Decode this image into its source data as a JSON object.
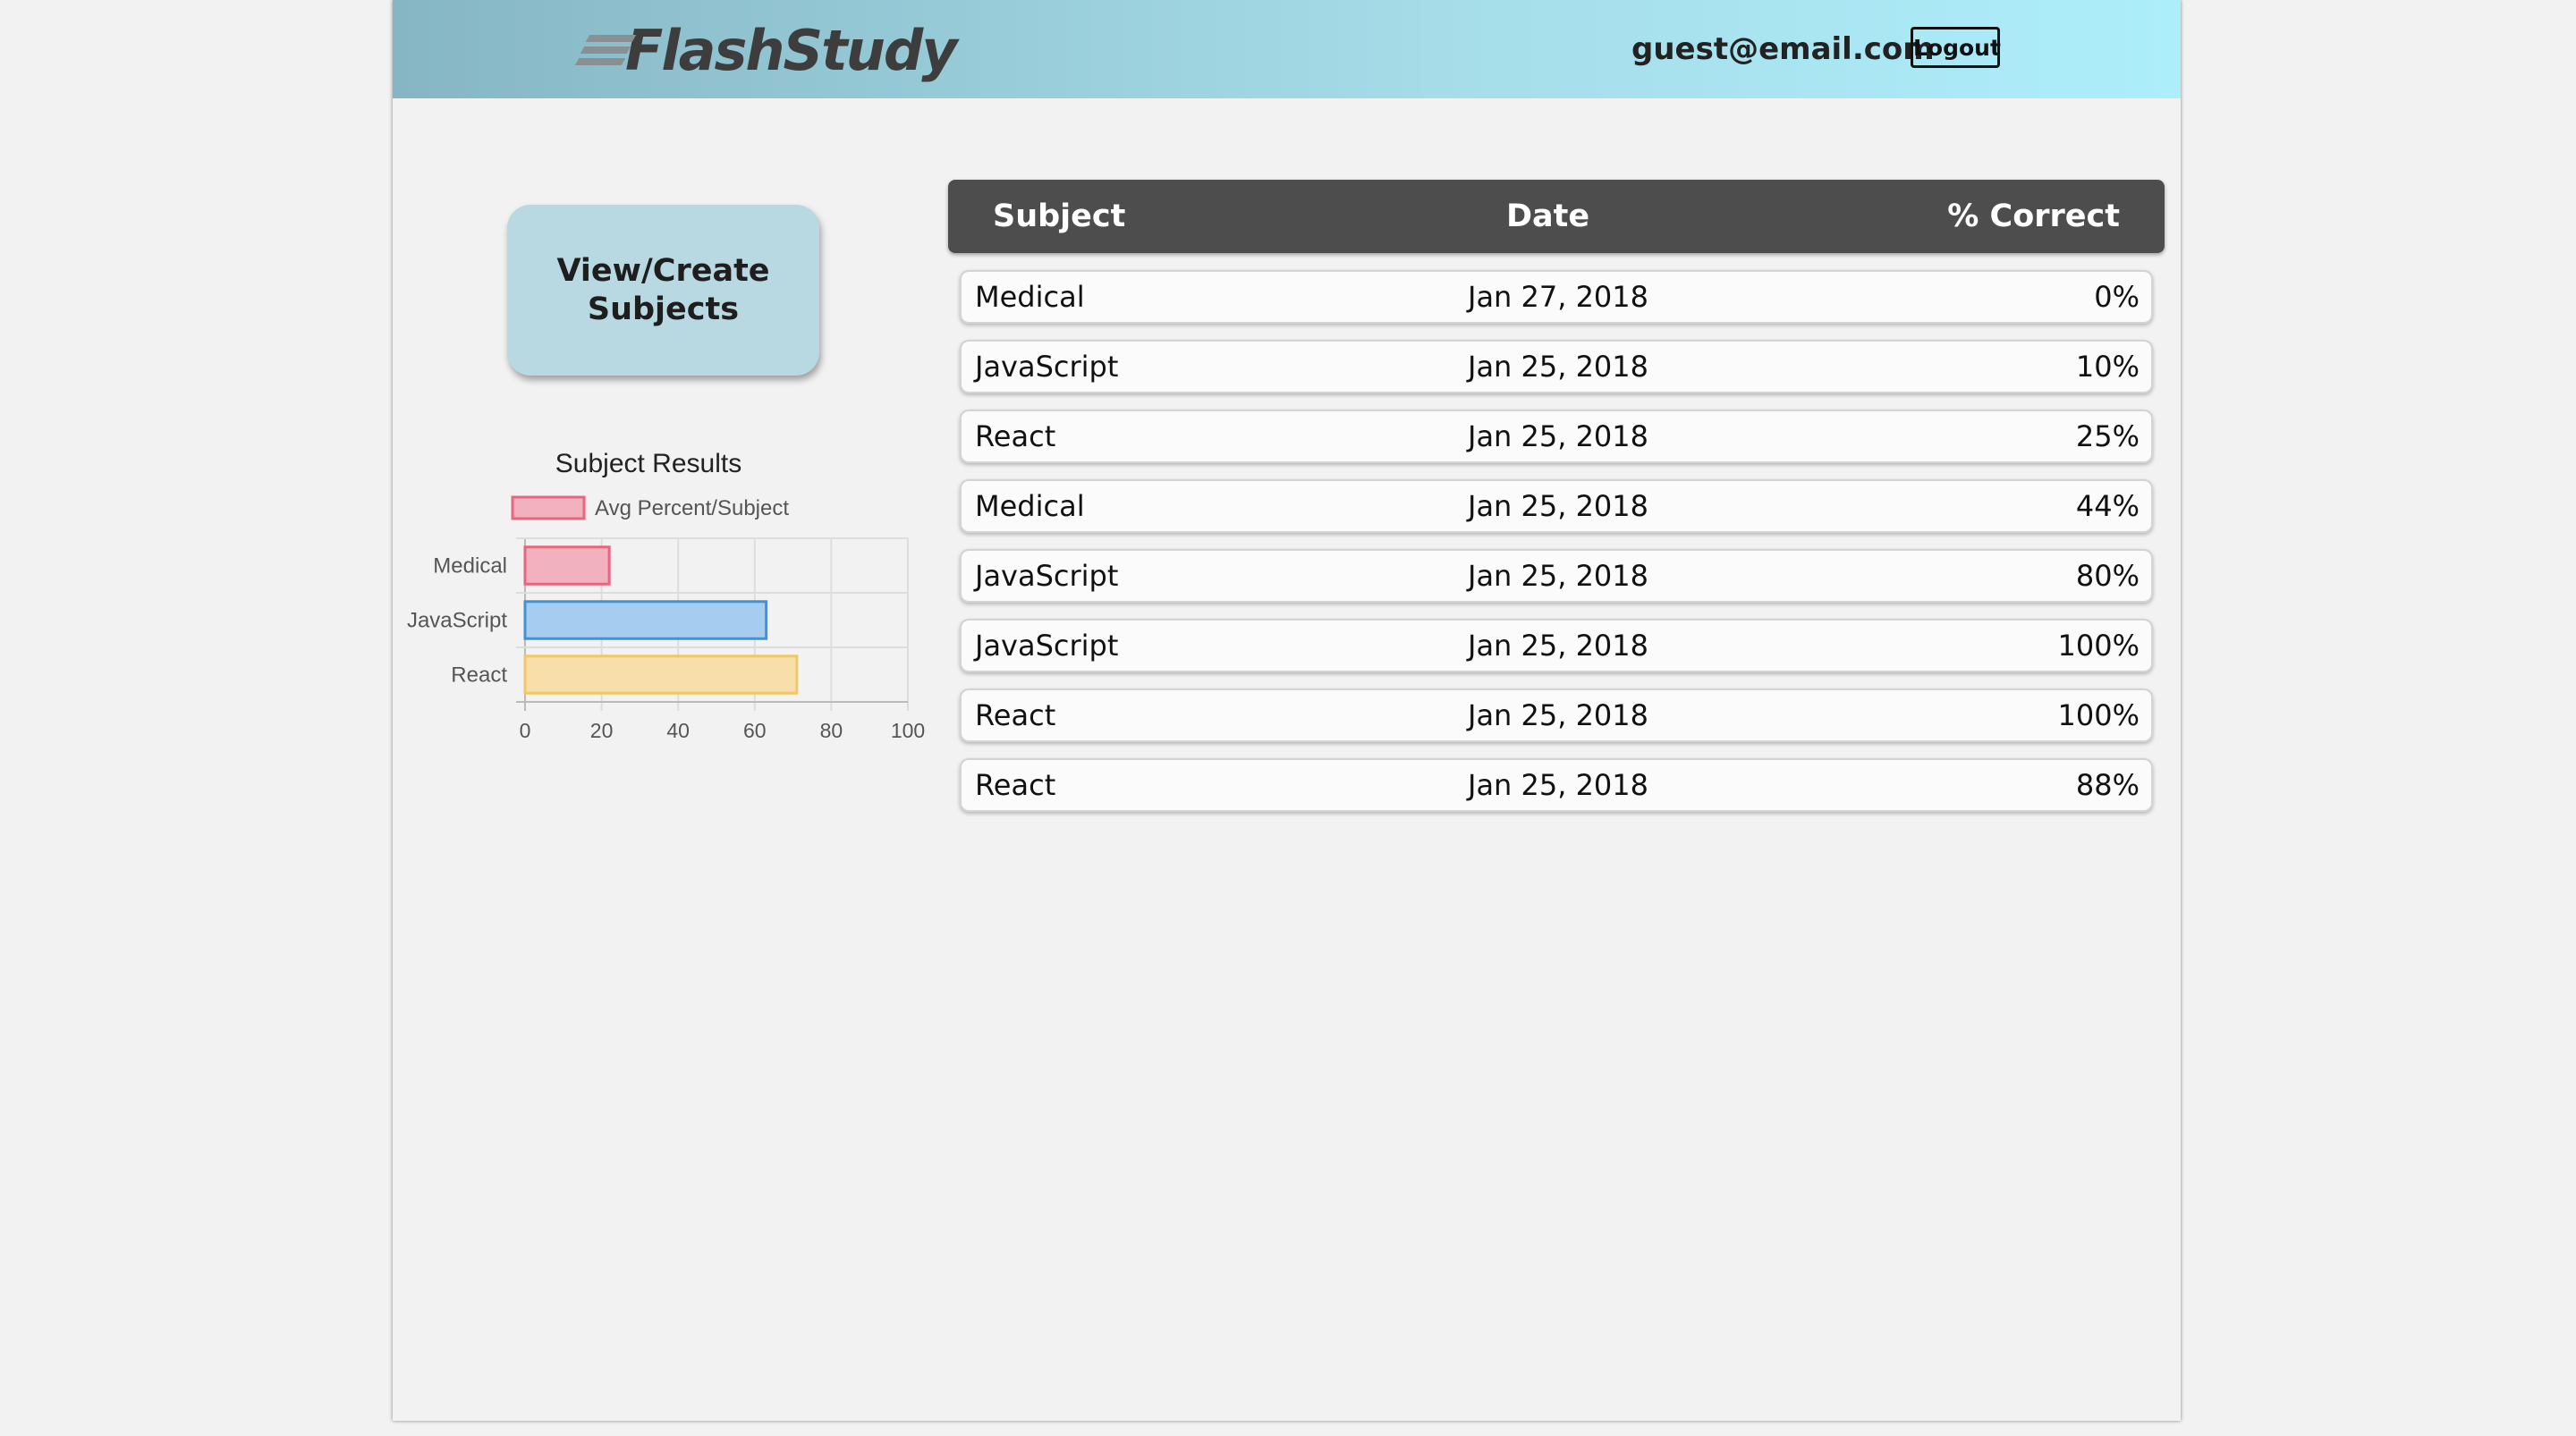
{
  "header": {
    "logo_text": "FlashStudy",
    "user_email": "guest@email.com",
    "logout_label": "Logout"
  },
  "sidebar": {
    "subjects_button_label": "View/Create Subjects"
  },
  "colors": {
    "header_gradient_start": "#86b6c4",
    "header_gradient_end": "#adeefb",
    "button_bg": "#b8d9e1",
    "table_header_bg": "#4d4d4d",
    "bar_medical": "#f2b1bf",
    "bar_javascript": "#a6cdef",
    "bar_react": "#f7deaa"
  },
  "chart_data": {
    "type": "bar",
    "orientation": "horizontal",
    "title": "Subject Results",
    "legend": [
      "Avg Percent/Subject"
    ],
    "legend_placement": "top",
    "categories": [
      "Medical",
      "JavaScript",
      "React"
    ],
    "series": [
      {
        "name": "Avg Percent/Subject",
        "values": [
          22,
          63,
          71
        ]
      }
    ],
    "xlim": [
      0,
      100
    ],
    "xticks": [
      "0",
      "20",
      "40",
      "60",
      "80",
      "100"
    ],
    "grid": true,
    "bar_colors": [
      {
        "fill": "#f2b1bf",
        "stroke": "#e8657f"
      },
      {
        "fill": "#a6cdef",
        "stroke": "#3f93d6"
      },
      {
        "fill": "#f7deaa",
        "stroke": "#f0c866"
      }
    ]
  },
  "results_table": {
    "columns": [
      "Subject",
      "Date",
      "% Correct"
    ],
    "rows": [
      {
        "subject": "Medical",
        "date": "Jan 27, 2018",
        "percent": "0%"
      },
      {
        "subject": "JavaScript",
        "date": "Jan 25, 2018",
        "percent": "10%"
      },
      {
        "subject": "React",
        "date": "Jan 25, 2018",
        "percent": "25%"
      },
      {
        "subject": "Medical",
        "date": "Jan 25, 2018",
        "percent": "44%"
      },
      {
        "subject": "JavaScript",
        "date": "Jan 25, 2018",
        "percent": "80%"
      },
      {
        "subject": "JavaScript",
        "date": "Jan 25, 2018",
        "percent": "100%"
      },
      {
        "subject": "React",
        "date": "Jan 25, 2018",
        "percent": "100%"
      },
      {
        "subject": "React",
        "date": "Jan 25, 2018",
        "percent": "88%"
      }
    ]
  }
}
